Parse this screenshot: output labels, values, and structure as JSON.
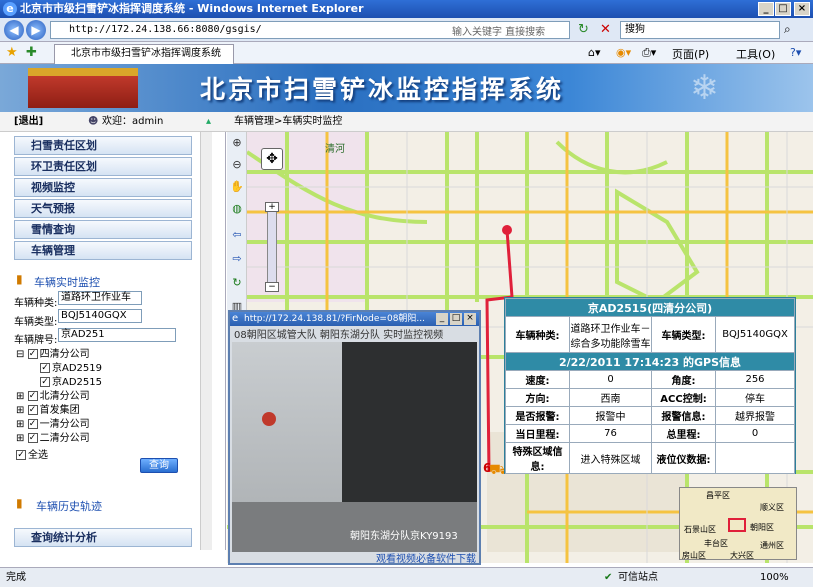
{
  "window": {
    "title": "北京市市级扫雪铲冰指挥调度系统 - Windows Internet Explorer"
  },
  "address": {
    "url": "http://172.24.138.66:8080/gsgis/",
    "search_hint": "输入关键字 直接搜索",
    "search_engine": "搜狗"
  },
  "tab": {
    "label": "北京市市级扫雪铲冰指挥调度系统"
  },
  "ie_toolbar": {
    "page": "页面(P)",
    "tools": "工具(O)"
  },
  "banner": {
    "title": "北京市扫雪铲冰监控指挥系统"
  },
  "infobar": {
    "logout": "[退出]",
    "welcome": "欢迎：admin",
    "breadcrumb": "车辆管理>车辆实时监控"
  },
  "sidebar": {
    "menus": [
      "扫雪责任区划",
      "环卫责任区划",
      "视频监控",
      "天气预报",
      "雪情查询",
      "车辆管理"
    ],
    "realtime_link": "车辆实时监控",
    "form": {
      "type_label": "车辆种类:",
      "type_value": "道路环卫作业车",
      "model_label": "车辆类型:",
      "model_value": "BQJ5140GQX",
      "plate_label": "车辆牌号:",
      "plate_value": "京AD251"
    },
    "tree": {
      "root": "四清分公司",
      "children": [
        "京AD2519",
        "京AD2515"
      ],
      "others": [
        "北清分公司",
        "首发集团",
        "一清分公司",
        "二清分公司"
      ]
    },
    "select_all": "全选",
    "query_button": "查询",
    "history_link": "车辆历史轨迹",
    "stats_menu": "查询统计分析"
  },
  "map": {
    "road_label": "清河",
    "marker_label": "6"
  },
  "vehicle_info": {
    "title": "京AD2515(四清分公司)",
    "kind_label": "车辆种类:",
    "kind_value": "道路环卫作业车－综合多功能除雪车",
    "model_label": "车辆类型:",
    "model_value": "BQJ5140GQX",
    "gps_title": "2/22/2011 17:14:23 的GPS信息",
    "rows": [
      {
        "l1": "速度:",
        "v1": "0",
        "l2": "角度:",
        "v2": "256"
      },
      {
        "l1": "方向:",
        "v1": "西南",
        "l2": "ACC控制:",
        "v2": "停车"
      },
      {
        "l1": "是否报警:",
        "v1": "报警中",
        "l2": "报警信息:",
        "v2": "越界报警"
      },
      {
        "l1": "当日里程:",
        "v1": "76",
        "l2": "总里程:",
        "v2": "0"
      },
      {
        "l1": "特殊区域信息:",
        "v1": "进入特殊区域",
        "l2": "液位仪数据:",
        "v2": ""
      }
    ]
  },
  "video": {
    "window_title": "http://172.24.138.81/?FirNode=08朝阳...",
    "caption": "08朝阳区城管大队 朝阳东湖分队 实时监控视频",
    "overlay": "朝阳东湖分队京KY9193",
    "footer": "观看视频必备软件下载"
  },
  "overview": {
    "labels": [
      "昌平区",
      "顺义区",
      "石景山区",
      "朝阳区",
      "通州区",
      "丰台区",
      "大兴区",
      "房山区"
    ]
  },
  "status": {
    "left": "完成",
    "trusted": "可信站点",
    "zoom": "100%"
  }
}
